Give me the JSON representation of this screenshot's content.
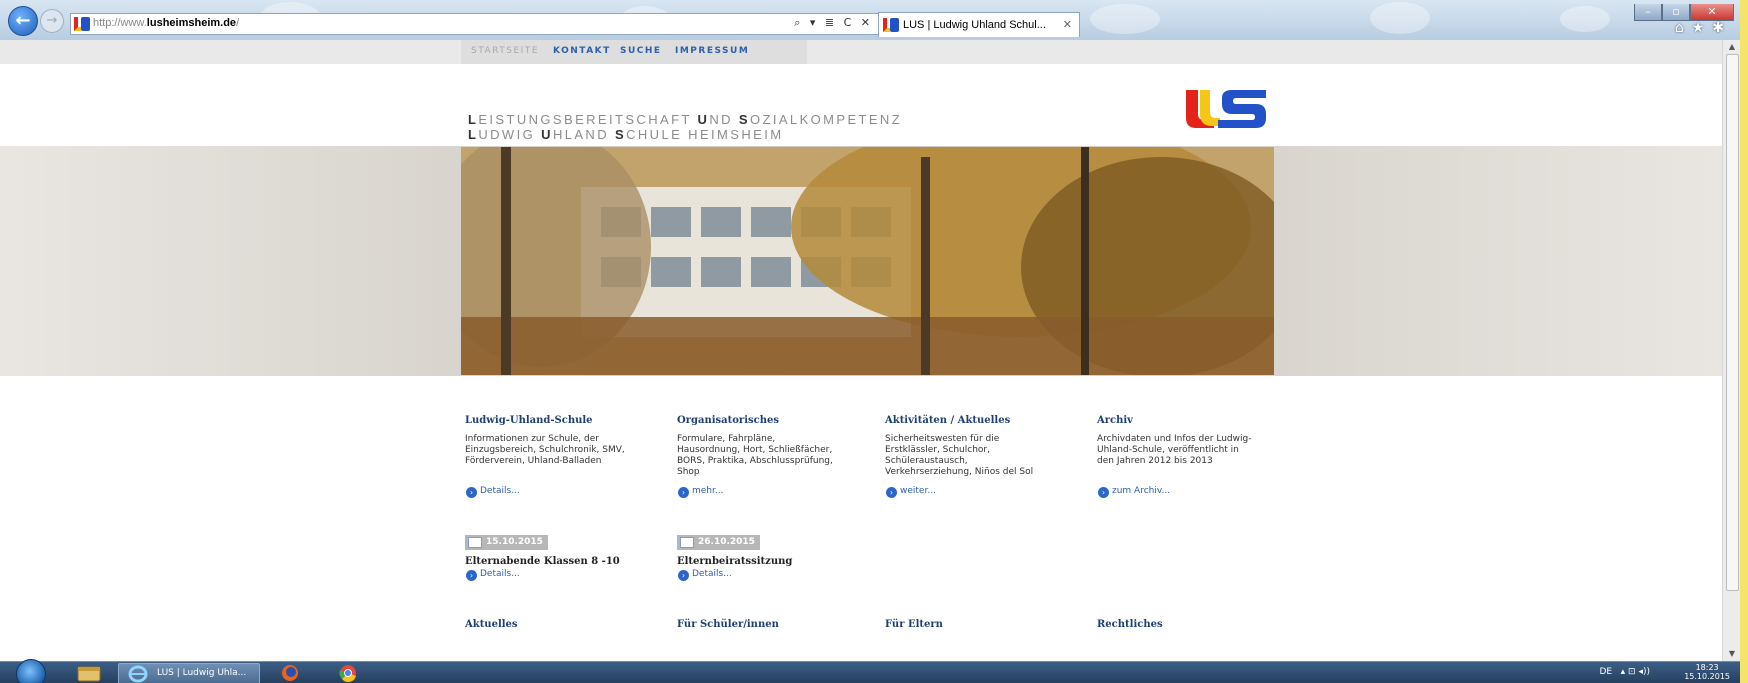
{
  "browser": {
    "url_prefix": "http://www.",
    "url_domain": "lusheimsheim.de",
    "url_suffix": "/",
    "address_tools": "⌕ ▾ ≣ C ✕",
    "tab_title": "LUS | Ludwig Uhland Schul...",
    "tab_close": "✕",
    "back_glyph": "←",
    "forward_glyph": "→",
    "window_controls": {
      "minimize": "–",
      "maximize": "▫",
      "close": "✕"
    },
    "right_icons": "⌂★✱"
  },
  "nav": {
    "items": [
      "STARTSEITE",
      "KONTAKT",
      "SUCHE",
      "IMPRESSUM"
    ]
  },
  "header": {
    "tagline_line1": [
      {
        "cap": "L",
        "rest": "EISTUNGSBEREITSCHAFT "
      },
      {
        "cap": "U",
        "rest": "ND "
      },
      {
        "cap": "S",
        "rest": "OZIALKOMPETENZ"
      }
    ],
    "tagline_line2": [
      {
        "cap": "L",
        "rest": "UDWIG "
      },
      {
        "cap": "U",
        "rest": "HLAND "
      },
      {
        "cap": "S",
        "rest": "CHULE HEIMSHEIM"
      }
    ],
    "logo_colors": {
      "red": "#e3241b",
      "yellow": "#f5c518",
      "blue": "#2351c7"
    }
  },
  "columns": [
    {
      "title": "Ludwig-Uhland-Schule",
      "text": "Informationen zur Schule, der Einzugsbereich, Schulchronik, SMV, Förderverein, Uhland-Balladen",
      "link": "Details..."
    },
    {
      "title": "Organisatorisches",
      "text": "Formulare, Fahrpläne, Hausordnung, Hort, Schließfächer, BORS, Praktika, Abschlussprüfung, Shop",
      "link": "mehr..."
    },
    {
      "title": "Aktivitäten / Aktuelles",
      "text": "Sicherheitswesten für die Erstklässler, Schulchor, Schüleraustausch, Verkehrserziehung, Niños del Sol",
      "link": "weiter..."
    },
    {
      "title": "Archiv",
      "text": "Archivdaten und Infos der Ludwig-Uhland-Schule, veröffentlicht in den Jahren 2012 bis 2013",
      "link": "zum Archiv..."
    }
  ],
  "events": [
    {
      "date": "15.10.2015",
      "title": "Elternabende Klassen 8 -10",
      "link": "Details..."
    },
    {
      "date": "26.10.2015",
      "title": "Elternbeiratssitzung",
      "link": "Details..."
    }
  ],
  "footer_headings": [
    "Aktuelles",
    "Für Schüler/innen",
    "Für Eltern",
    "Rechtliches"
  ],
  "taskbar": {
    "ie_label": "LUS | Ludwig Uhla...",
    "lang": "DE",
    "tray_icons": "▴ ⊡ ◂))",
    "time": "18:23",
    "date": "15.10.2015"
  },
  "scrollbar": {
    "up": "▲",
    "down": "▼"
  }
}
